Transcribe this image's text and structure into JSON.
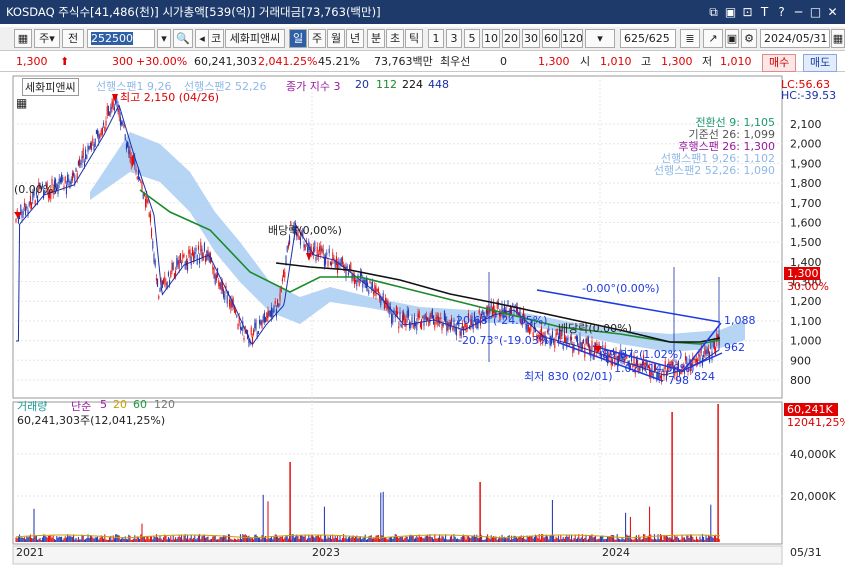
{
  "window": {
    "title": "KOSDAQ 주식수[41,486(천)] 시가총액[539(억)] 거래대금[73,763(백만)]",
    "controls": [
      "⧉",
      "▣",
      "⊡",
      "T",
      "?",
      "─",
      "□",
      "✕"
    ]
  },
  "toolbar": {
    "type_label": "주",
    "prev_label": "전",
    "code_value": "252500",
    "code_label": "코",
    "stock_name": "세화피앤씨",
    "periods": [
      "일",
      "주",
      "월",
      "년",
      "분",
      "초",
      "틱"
    ],
    "selected_period": "일",
    "intervals": [
      "1",
      "3",
      "5",
      "10",
      "20",
      "30",
      "60",
      "120"
    ],
    "count": "625/625",
    "date": "2024/05/31"
  },
  "infobar": {
    "price": "1,300",
    "change": "300",
    "change_pct": "+30.00%",
    "volume": "60,241,303",
    "volume_pct": "2,041.25%",
    "turnover_pct": "45.21%",
    "amount": "73,763백만",
    "best_label": "최우선",
    "best_value": "0",
    "price2": "1,300",
    "open_label": "시",
    "open": "1,010",
    "high_label": "고",
    "high": "1,300",
    "low_label": "저",
    "low": "1,010",
    "buy_label": "매수",
    "sell_label": "매도"
  },
  "price_panel": {
    "legend_name": "세화피앤씨",
    "legend_span1": "선행스팬1 9,26",
    "legend_span2": "선행스팬2 52,26",
    "legend_close": "종가 지수 3",
    "legend_ma": [
      "20",
      "112",
      "224",
      "448"
    ],
    "lc": "LC:56.63",
    "hc": "HC:-39.53",
    "ichimoku": [
      {
        "label": "전환선 9: 1,105",
        "color": "#1a9a6a"
      },
      {
        "label": "기준선 26: 1,099",
        "color": "#555555"
      },
      {
        "label": "후행스팬 26: 1,300",
        "color": "#9a1aa0"
      },
      {
        "label": "선행스팬1 9,26: 1,102",
        "color": "#8fb8e8"
      },
      {
        "label": "선행스팬2 52,26: 1,090",
        "color": "#8fb8e8"
      }
    ],
    "high_annotation": "최고 2,150 (04/26)",
    "low_annotation": "최저 830 (02/01)",
    "dividend": "배당락(0,00%)",
    "left_pct": "(0.00%)",
    "trend_labels": [
      "-0.00°(0.00%)",
      "-20.68°(-24.05%)",
      "-20.73°(-19.03%)",
      "배당락(0.00%)",
      "-89.67°(1.02%)",
      "1.02°(14.56%)"
    ],
    "point_labels": [
      "1,088",
      "962",
      "798",
      "824"
    ],
    "current_price": "1,300",
    "current_pct": "30.00%",
    "y_ticks": [
      "2,100",
      "2,000",
      "1,900",
      "1,800",
      "1,700",
      "1,600",
      "1,500",
      "1,400",
      "1,300",
      "1,200",
      "1,100",
      "1,000",
      "900",
      "800"
    ]
  },
  "volume_panel": {
    "legend_name": "거래량",
    "legend_simple": "단순",
    "legend_ma": [
      {
        "label": "5",
        "color": "#9a1aa0"
      },
      {
        "label": "20",
        "color": "#c8a000"
      },
      {
        "label": "60",
        "color": "#1a9a3a"
      },
      {
        "label": "120",
        "color": "#777777"
      }
    ],
    "volume_text": "60,241,303주(12,041,25%)",
    "current_volume": "60,241K",
    "current_volume_pct": "12041,25%",
    "y_ticks": [
      "40,000K",
      "20,000K"
    ]
  },
  "x_axis": {
    "labels": [
      "2021",
      "2023",
      "2024"
    ],
    "right_label": "05/31"
  }
}
